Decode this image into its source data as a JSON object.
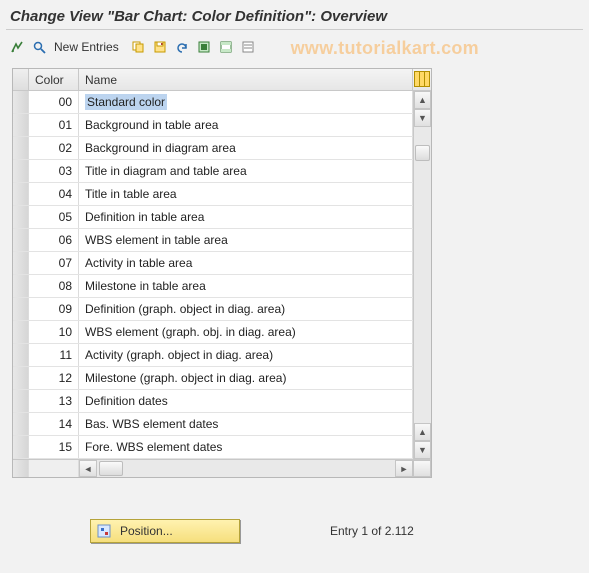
{
  "title": "Change View \"Bar Chart: Color Definition\": Overview",
  "toolbar": {
    "new_entries_label": "New Entries"
  },
  "watermark": "www.tutorialkart.com",
  "table": {
    "headers": {
      "color": "Color",
      "name": "Name"
    },
    "rows": [
      {
        "code": "00",
        "name": "Standard color",
        "selected": true
      },
      {
        "code": "01",
        "name": "Background in table area"
      },
      {
        "code": "02",
        "name": "Background in diagram area"
      },
      {
        "code": "03",
        "name": "Title in diagram and table area"
      },
      {
        "code": "04",
        "name": "Title in table area"
      },
      {
        "code": "05",
        "name": "Definition in table area"
      },
      {
        "code": "06",
        "name": "WBS element in table area"
      },
      {
        "code": "07",
        "name": "Activity in table area"
      },
      {
        "code": "08",
        "name": "Milestone in table area"
      },
      {
        "code": "09",
        "name": "Definition (graph. object in diag. area)"
      },
      {
        "code": "10",
        "name": "WBS element (graph. obj. in diag. area)"
      },
      {
        "code": "11",
        "name": "Activity (graph. object in diag. area)"
      },
      {
        "code": "12",
        "name": "Milestone (graph. object in diag. area)"
      },
      {
        "code": "13",
        "name": "Definition dates"
      },
      {
        "code": "14",
        "name": "Bas. WBS element dates"
      },
      {
        "code": "15",
        "name": "Fore. WBS element dates"
      }
    ]
  },
  "footer": {
    "position_label": "Position...",
    "entry_text": "Entry 1 of 2.112"
  }
}
